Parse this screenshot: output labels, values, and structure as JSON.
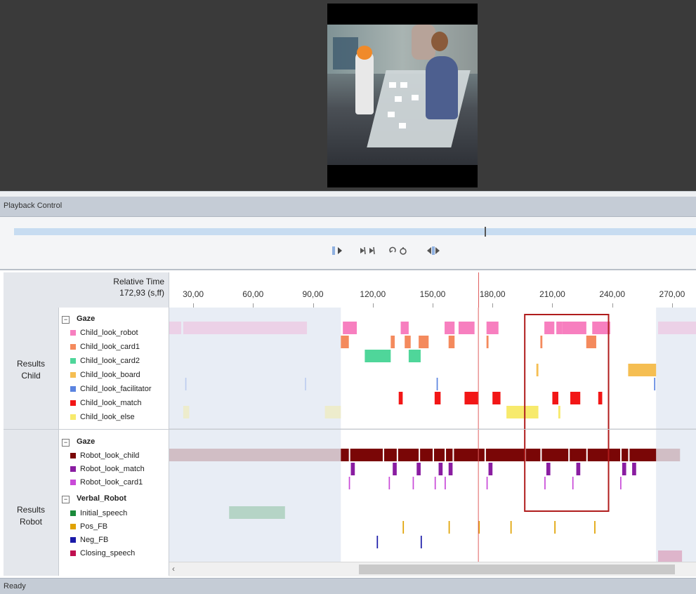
{
  "playback": {
    "header": "Playback Control",
    "buttons": [
      "play-icon",
      "step-frame-icon",
      "loop-icon",
      "jump-icon"
    ],
    "position_fraction": 0.691
  },
  "timeline": {
    "relative_time_label": "Relative Time",
    "current_time": "172,93 (s,ff)",
    "view_range": [
      18,
      282
    ],
    "ticks": [
      "30,00",
      "60,00",
      "90,00",
      "120,00",
      "150,00",
      "180,00",
      "210,00",
      "240,00",
      "270,00"
    ],
    "cursor_time": 172.93,
    "groups": {
      "child": "Results\nChild",
      "robot": "Results\nRobot"
    },
    "child_legend": {
      "group_name": "Gaze",
      "items": [
        {
          "label": "Child_look_robot",
          "color": "#f77fbf"
        },
        {
          "label": "Child_look_card1",
          "color": "#f48a5d"
        },
        {
          "label": "Child_look_card2",
          "color": "#4fd69a"
        },
        {
          "label": "Child_look_board",
          "color": "#f5be52"
        },
        {
          "label": "Child_look_facilitator",
          "color": "#5b84e0"
        },
        {
          "label": "Child_look_match",
          "color": "#f21616"
        },
        {
          "label": "Child_look_else",
          "color": "#f7ea6c"
        }
      ]
    },
    "robot_legend": {
      "gaze_group": "Gaze",
      "gaze_items": [
        {
          "label": "Robot_look_child",
          "color": "#7a0606"
        },
        {
          "label": "Robot_look_match",
          "color": "#8a1da1"
        },
        {
          "label": "Robot_look_card1",
          "color": "#c94ad8"
        }
      ],
      "verbal_group": "Verbal_Robot",
      "verbal_items": [
        {
          "label": "Initial_speech",
          "color": "#1a8a3a"
        },
        {
          "label": "Pos_FB",
          "color": "#e0a200"
        },
        {
          "label": "Neg_FB",
          "color": "#1a1aa8"
        },
        {
          "label": "Closing_speech",
          "color": "#c01050"
        }
      ]
    }
  },
  "status": "Ready"
}
